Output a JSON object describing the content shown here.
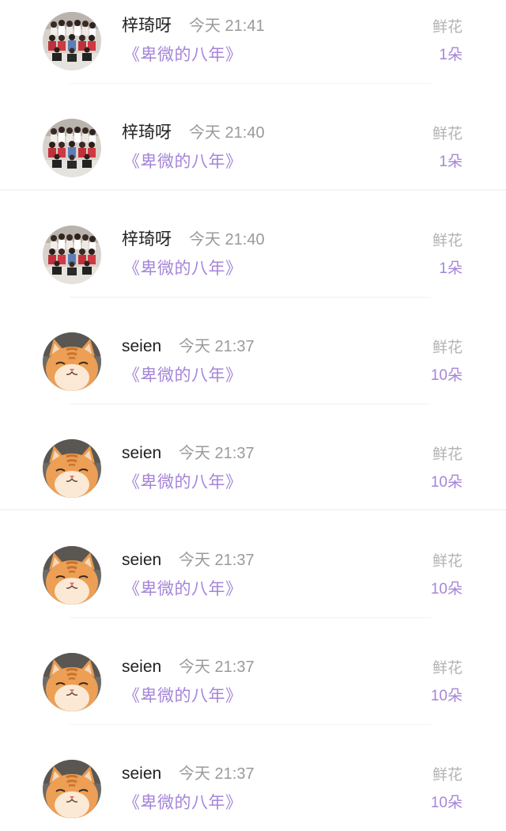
{
  "gift_list": {
    "items": [
      {
        "user": "梓琦呀",
        "time": "今天 21:41",
        "work": "《卑微的八年》",
        "gift_label": "鲜花",
        "gift_count": "1朵",
        "avatar": "group-photo-avatar"
      },
      {
        "user": "梓琦呀",
        "time": "今天 21:40",
        "work": "《卑微的八年》",
        "gift_label": "鲜花",
        "gift_count": "1朵",
        "avatar": "group-photo-avatar"
      },
      {
        "user": "梓琦呀",
        "time": "今天 21:40",
        "work": "《卑微的八年》",
        "gift_label": "鲜花",
        "gift_count": "1朵",
        "avatar": "group-photo-avatar"
      },
      {
        "user": "seien",
        "time": "今天 21:37",
        "work": "《卑微的八年》",
        "gift_label": "鲜花",
        "gift_count": "10朵",
        "avatar": "cat-avatar"
      },
      {
        "user": "seien",
        "time": "今天 21:37",
        "work": "《卑微的八年》",
        "gift_label": "鲜花",
        "gift_count": "10朵",
        "avatar": "cat-avatar"
      },
      {
        "user": "seien",
        "time": "今天 21:37",
        "work": "《卑微的八年》",
        "gift_label": "鲜花",
        "gift_count": "10朵",
        "avatar": "cat-avatar"
      },
      {
        "user": "seien",
        "time": "今天 21:37",
        "work": "《卑微的八年》",
        "gift_label": "鲜花",
        "gift_count": "10朵",
        "avatar": "cat-avatar"
      },
      {
        "user": "seien",
        "time": "今天 21:37",
        "work": "《卑微的八年》",
        "gift_label": "鲜花",
        "gift_count": "10朵",
        "avatar": "cat-avatar"
      }
    ]
  },
  "colors": {
    "accent": "#a585d8",
    "name_text": "#222222",
    "muted_text": "#9a9a9a",
    "gift_label": "#b3b3b3"
  }
}
